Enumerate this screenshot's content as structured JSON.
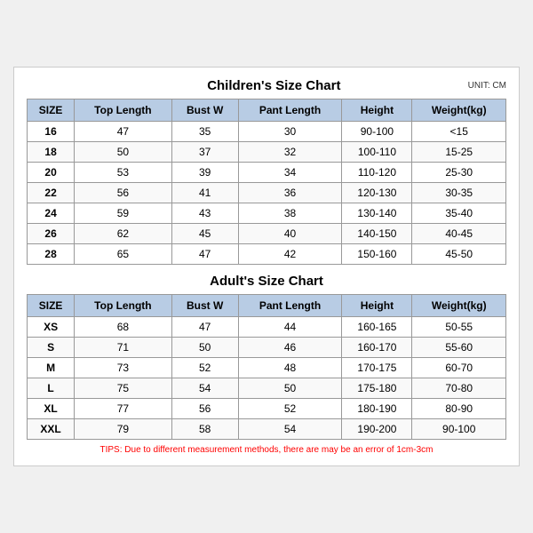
{
  "chartTitle": "Children's Size Chart",
  "adultTitle": "Adult's Size Chart",
  "unit": "UNIT: CM",
  "tips": "TIPS: Due to different measurement methods, there are may be an error of 1cm-3cm",
  "headers": [
    "SIZE",
    "Top Length",
    "Bust W",
    "Pant Length",
    "Height",
    "Weight(kg)"
  ],
  "childrenRows": [
    [
      "16",
      "47",
      "35",
      "30",
      "90-100",
      "<15"
    ],
    [
      "18",
      "50",
      "37",
      "32",
      "100-110",
      "15-25"
    ],
    [
      "20",
      "53",
      "39",
      "34",
      "110-120",
      "25-30"
    ],
    [
      "22",
      "56",
      "41",
      "36",
      "120-130",
      "30-35"
    ],
    [
      "24",
      "59",
      "43",
      "38",
      "130-140",
      "35-40"
    ],
    [
      "26",
      "62",
      "45",
      "40",
      "140-150",
      "40-45"
    ],
    [
      "28",
      "65",
      "47",
      "42",
      "150-160",
      "45-50"
    ]
  ],
  "adultRows": [
    [
      "XS",
      "68",
      "47",
      "44",
      "160-165",
      "50-55"
    ],
    [
      "S",
      "71",
      "50",
      "46",
      "160-170",
      "55-60"
    ],
    [
      "M",
      "73",
      "52",
      "48",
      "170-175",
      "60-70"
    ],
    [
      "L",
      "75",
      "54",
      "50",
      "175-180",
      "70-80"
    ],
    [
      "XL",
      "77",
      "56",
      "52",
      "180-190",
      "80-90"
    ],
    [
      "XXL",
      "79",
      "58",
      "54",
      "190-200",
      "90-100"
    ]
  ]
}
